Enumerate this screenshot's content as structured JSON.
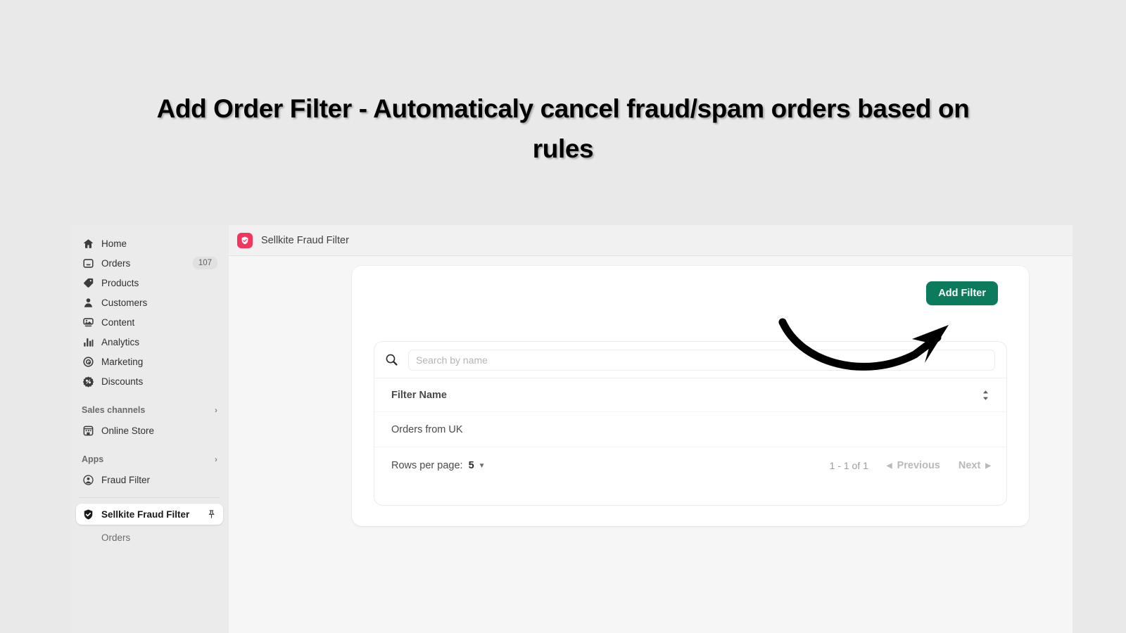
{
  "hero": {
    "title": "Add Order Filter - Automaticaly cancel fraud/spam orders based on rules"
  },
  "sidebar": {
    "items": [
      {
        "label": "Home",
        "icon": "home-icon",
        "badge": ""
      },
      {
        "label": "Orders",
        "icon": "orders-icon",
        "badge": "107"
      },
      {
        "label": "Products",
        "icon": "products-icon",
        "badge": ""
      },
      {
        "label": "Customers",
        "icon": "customers-icon",
        "badge": ""
      },
      {
        "label": "Content",
        "icon": "content-icon",
        "badge": ""
      },
      {
        "label": "Analytics",
        "icon": "analytics-icon",
        "badge": ""
      },
      {
        "label": "Marketing",
        "icon": "marketing-icon",
        "badge": ""
      },
      {
        "label": "Discounts",
        "icon": "discounts-icon",
        "badge": ""
      }
    ],
    "sales_channels": {
      "label": "Sales channels",
      "chevron": "›",
      "items": [
        {
          "label": "Online Store",
          "icon": "store-icon"
        }
      ]
    },
    "apps": {
      "label": "Apps",
      "chevron": "›",
      "items": [
        {
          "label": "Fraud Filter",
          "icon": "fraud-filter-app-icon"
        }
      ]
    },
    "active_item": {
      "label": "Sellkite Fraud Filter",
      "icon": "shield-check-icon",
      "pin_icon": "pin-icon"
    },
    "sub_item": {
      "label": "Orders"
    }
  },
  "app_topbar": {
    "title": "Sellkite Fraud Filter",
    "icon": "sellkite-app-icon",
    "icon_color": "#f3365c"
  },
  "card": {
    "add_filter_label": "Add Filter",
    "add_filter_color": "#0c7a5c",
    "search": {
      "placeholder": "Search by name",
      "value": "",
      "icon": "search-icon"
    },
    "table": {
      "columns": [
        "Filter Name"
      ],
      "sort_icon": "sort-icon",
      "rows": [
        {
          "filter_name": "Orders from UK"
        }
      ]
    },
    "pagination": {
      "rows_per_page_label": "Rows per page:",
      "rows_per_page_value": "5",
      "caret_icon": "chevron-down-icon",
      "range_label": "1 - 1 of 1",
      "previous_label": "Previous",
      "next_label": "Next",
      "prev_icon": "triangle-left-icon",
      "next_icon": "triangle-right-icon"
    }
  },
  "annotation": {
    "arrow": "curved-arrow-up-right"
  }
}
